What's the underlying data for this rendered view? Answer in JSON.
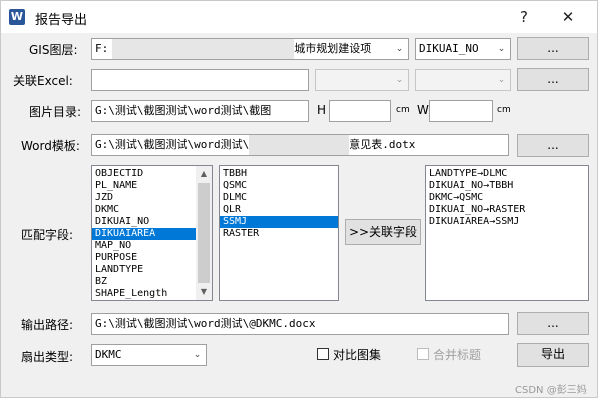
{
  "window": {
    "title": "报告导出",
    "app_icon": "W",
    "help": "?",
    "close": "✕"
  },
  "gis_layer": {
    "label": "GIS图层:",
    "path_prefix": "F:",
    "path_suffix": "城市规划建设项",
    "layer_combo_arrow": "⌄",
    "field_value": "DIKUAI_NO",
    "browse_label": "..."
  },
  "excel": {
    "label": "关联Excel:",
    "value": "",
    "browse_label": "..."
  },
  "image_dir": {
    "label": "图片目录:",
    "value": "G:\\测试\\截图测试\\word测试\\截图",
    "h_label": "H",
    "h_value": "",
    "h_unit": "cm",
    "w_label": "W",
    "w_value": "",
    "w_unit": "cm"
  },
  "word_template": {
    "label": "Word模板:",
    "value_prefix": "G:\\测试\\截图测试\\word测试\\",
    "value_suffix": "意见表.dotx",
    "browse_label": "..."
  },
  "match_fields": {
    "label": "匹配字段:",
    "source_fields": [
      "OBJECTID",
      "PL_NAME",
      "JZD",
      "DKMC",
      "DIKUAI_NO",
      "DIKUAIAREA",
      "MAP_NO",
      "PURPOSE",
      "LANDTYPE",
      "BZ",
      "SHAPE_Length"
    ],
    "source_selected_index": 5,
    "target_fields": [
      "TBBH",
      "QSMC",
      "DLMC",
      "QLR",
      "SSMJ",
      "RASTER"
    ],
    "target_selected_index": 4,
    "link_button_label": ">>关联字段",
    "mappings": [
      "LANDTYPE→DLMC",
      "DIKUAI_NO→TBBH",
      "DKMC→QSMC",
      "DIKUAI_NO→RASTER",
      "DIKUAIAREA→SSMJ"
    ]
  },
  "output": {
    "label": "输出路径:",
    "value": "G:\\测试\\截图测试\\word测试\\@DKMC.docx",
    "browse_label": "..."
  },
  "naming": {
    "label": "扇出类型:",
    "value": "DKMC",
    "compare_label": "对比图集",
    "compare_checked": false,
    "merge_label": "合并标题",
    "merge_checked": false,
    "merge_disabled": true,
    "export_label": "导出"
  },
  "watermark": "CSDN @彭三妈"
}
